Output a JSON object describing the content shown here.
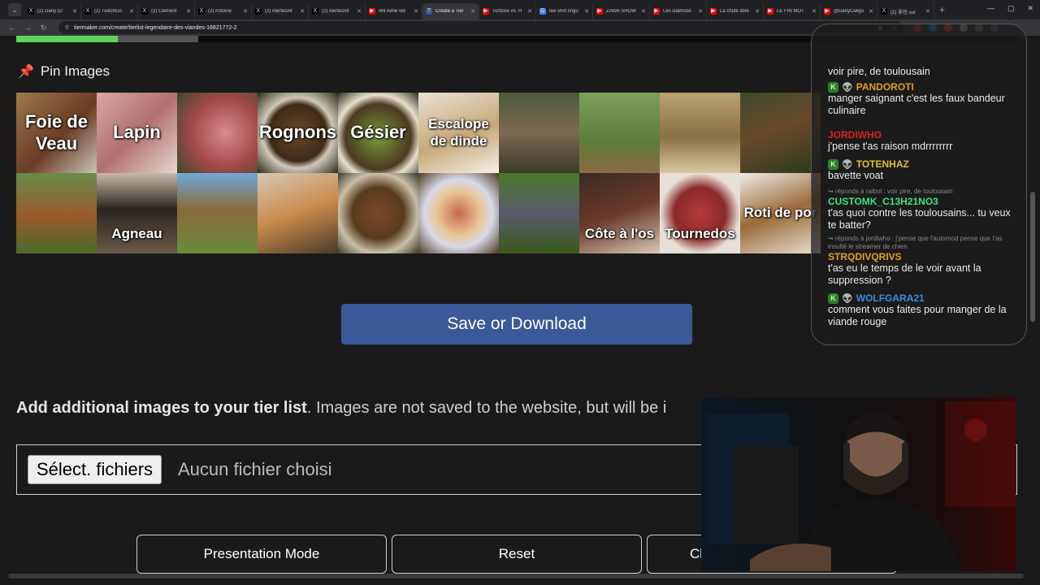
{
  "browser": {
    "tabs": [
      {
        "label": "(2) Dany (D",
        "color": "#000000",
        "glyph": "X"
      },
      {
        "label": "(2) TwitchGo",
        "color": "#000000",
        "glyph": "X"
      },
      {
        "label": "(2) Clément",
        "color": "#000000",
        "glyph": "X"
      },
      {
        "label": "(2) Antoine",
        "color": "#000000",
        "glyph": "X"
      },
      {
        "label": "(2) Alertesinf",
        "color": "#000000",
        "glyph": "X"
      },
      {
        "label": "(2) Alertesinf",
        "color": "#000000",
        "glyph": "X"
      },
      {
        "label": "Wil Aime vid",
        "color": "#ff0000",
        "glyph": "▶"
      },
      {
        "label": "Create a Tier",
        "color": "#3b5998",
        "glyph": "T",
        "active": true
      },
      {
        "label": "Tortoise vs. H",
        "color": "#ff0000",
        "glyph": "▶"
      },
      {
        "label": "tee shirt lingu",
        "color": "#4285f4",
        "glyph": "G"
      },
      {
        "label": "ZAWA SHOW",
        "color": "#ff0000",
        "glyph": "▶"
      },
      {
        "label": "Les islamiste",
        "color": "#ff0000",
        "glyph": "▶"
      },
      {
        "label": "La chute libre",
        "color": "#ff0000",
        "glyph": "▶"
      },
      {
        "label": "LE FIN MOT",
        "color": "#ff0000",
        "glyph": "▶"
      },
      {
        "label": "@DanyCaligu",
        "color": "#ff0000",
        "glyph": "▶"
      },
      {
        "label": "(2) 非也 sur",
        "color": "#000000",
        "glyph": "X"
      }
    ],
    "url": "tiermaker.com/create/tierlist-legendaire-des-viandes-16821772-2"
  },
  "pin_title": "Pin Images",
  "tiles": [
    {
      "label": "Foie de Veau",
      "bg": "linear-gradient(135deg,#9c7a4c,#6b3b24 55%,#c9c3b8)",
      "sm": false,
      "bottom": false
    },
    {
      "label": "Lapin",
      "bg": "linear-gradient(135deg,#d9a8a8,#b07070 50%,#e8d6d0)",
      "sm": false,
      "bottom": false
    },
    {
      "label": "",
      "bg": "radial-gradient(circle at 60% 50%,#d88a8a,#a24848 55%,#3a4a2a)"
    },
    {
      "label": "Rognons",
      "bg": "radial-gradient(circle at 50% 50%,#6b4a2a,#3d2a16 50%,#cfc8b8 62%,#2a2a1c)",
      "sm": false,
      "bottom": false
    },
    {
      "label": "Gésier",
      "bg": "radial-gradient(circle at 50% 55%,#7a9a3a,#4a3a20 55%,#e8e0cc 70%,#2c2c22)",
      "sm": false,
      "bottom": false
    },
    {
      "label": "Escalope de dinde",
      "bg": "linear-gradient(160deg,#e8e2d4,#c8a878 55%,#f4f0e8)",
      "sm": true,
      "bottom": false
    },
    {
      "label": "",
      "bg": "linear-gradient(180deg,#4e5a3a,#7a6a50 50%,#3a3a2a)"
    },
    {
      "label": "",
      "bg": "linear-gradient(180deg,#7ba05b,#5d7d3a 60%,#8a6a44)"
    },
    {
      "label": "",
      "bg": "linear-gradient(180deg,#b9a272,#8a7046 55%,#d8c8a0)"
    },
    {
      "label": "",
      "bg": "linear-gradient(160deg,#3c4a2a,#6a4a2a 45%,#2a3a1c)"
    },
    {
      "label": "",
      "bg": "linear-gradient(180deg,#6a8a4a,#9a5a2a 55%,#4a6a2a)"
    },
    {
      "label": "Agneau",
      "bg": "linear-gradient(180deg,#c8b8a8,#2a2420 45%,#6a5a4a)",
      "sm": true,
      "bottom": true
    },
    {
      "label": "",
      "bg": "linear-gradient(180deg,#6fa8d8,#8a6a3a 45%,#6a8a3a)"
    },
    {
      "label": "",
      "bg": "linear-gradient(160deg,#d8c8b8,#c88a4a 50%,#4a3a2a)"
    },
    {
      "label": "",
      "bg": "radial-gradient(circle,#7a4a2a,#5a3a1c 45%,#c8c0a8 70%,#3a3a2a)"
    },
    {
      "label": "",
      "bg": "radial-gradient(circle,#c86a4a,#e8c89a 40%,#d8d8e8 60%,#4a3a22)"
    },
    {
      "label": "",
      "bg": "linear-gradient(180deg,#4a7a2a,#5a5a6a 50%,#3a5a1c)"
    },
    {
      "label": "Côte à l'os",
      "bg": "linear-gradient(160deg,#3a2a22,#6a3a2a 50%,#d8c8b8)",
      "sm": true,
      "bottom": true
    },
    {
      "label": "Tournedos",
      "bg": "radial-gradient(circle,#b83a3a,#8a2a2a 45%,#e8e0d8 70%)",
      "sm": true,
      "bottom": true
    },
    {
      "label": "Roti de por",
      "bg": "linear-gradient(160deg,#f0ece4,#9a6a3a 50%,#e8e0d0)",
      "sm": true,
      "bottom": false
    }
  ],
  "save_label": "Save or Download",
  "add_images": {
    "bold": "Add additional images to your tier list",
    "rest": ". Images are not saved to the website, but will be i"
  },
  "file_input": {
    "button": "Sélect. fichiers",
    "status": "Aucun fichier choisi"
  },
  "bottom_buttons": [
    "Presentation Mode",
    "Reset",
    "Cl"
  ],
  "chat": [
    {
      "reply": "",
      "user": "",
      "user_color": "#e05050",
      "badges": false,
      "text": "voir pire, de toulousain"
    },
    {
      "reply": "",
      "user": "PANDOROTI",
      "user_color": "#e0a020",
      "badges": true,
      "text": "manger saignant c'est les faux bandeur culinaire"
    },
    {
      "reply": "",
      "user": "JORDIWHO",
      "user_color": "#e02020",
      "badges": false,
      "text": "j'pense t'as raison mdrrrrrrrr"
    },
    {
      "reply": "",
      "user": "TOTENHAZ",
      "user_color": "#e0c030",
      "badges": true,
      "text": "bavette voat"
    },
    {
      "reply": "↪ réponds à raibol : voir pire, de toulousain",
      "user": "CUSTOMK_C13H21NO3",
      "user_color": "#40e080",
      "badges": false,
      "text": "t'as quoi contre les toulousains... tu veux te batter?"
    },
    {
      "reply": "↪ réponds à jordiwho : j'pense que l'automod pense que t'as insulté le streamer de chien",
      "user": "STRQDIVQRIVS",
      "user_color": "#e0a020",
      "badges": false,
      "text": "t'as eu le temps de le voir avant la suppression ?"
    },
    {
      "reply": "",
      "user": "WOLFGARA21",
      "user_color": "#3a8ae0",
      "badges": true,
      "text": "comment vous faites pour manger de la viande rouge"
    }
  ]
}
